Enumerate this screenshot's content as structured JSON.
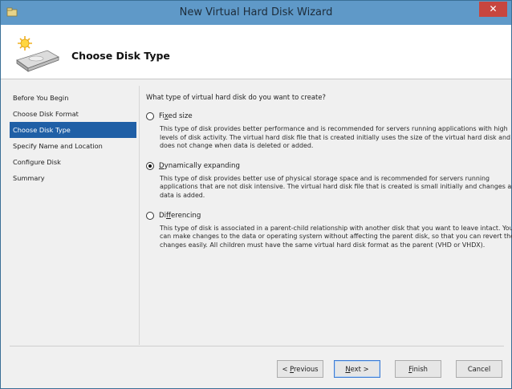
{
  "window": {
    "title": "New Virtual Hard Disk Wizard",
    "close_glyph": "✕"
  },
  "header": {
    "heading": "Choose Disk Type"
  },
  "nav": {
    "items": [
      {
        "label": "Before You Begin"
      },
      {
        "label": "Choose Disk Format"
      },
      {
        "label": "Choose Disk Type",
        "selected": true
      },
      {
        "label": "Specify Name and Location"
      },
      {
        "label": "Configure Disk"
      },
      {
        "label": "Summary"
      }
    ]
  },
  "main": {
    "question": "What type of virtual hard disk do you want to create?",
    "options": [
      {
        "label_prefix": "Fi",
        "label_underline": "x",
        "label_suffix": "ed size",
        "checked": false,
        "description": "This type of disk provides better performance and is recommended for servers running applications with high levels of disk activity. The virtual hard disk file that is created initially uses the size of the virtual hard disk and does not change when data is deleted or added."
      },
      {
        "label_prefix": "",
        "label_underline": "D",
        "label_suffix": "ynamically expanding",
        "checked": true,
        "description": "This type of disk provides better use of physical storage space and is recommended for servers running applications that are not disk intensive. The virtual hard disk file that is created is small initially and changes as data is added."
      },
      {
        "label_prefix": "Di",
        "label_underline": "f",
        "label_suffix": "ferencing",
        "checked": false,
        "description": "This type of disk is associated in a parent-child relationship with another disk that you want to leave intact. You can make changes to the data or operating system without affecting the parent disk, so that you can revert the changes easily. All children must have the same virtual hard disk format as the parent (VHD or VHDX)."
      }
    ]
  },
  "footer": {
    "previous": {
      "prefix": "< ",
      "underline": "P",
      "suffix": "revious"
    },
    "next": {
      "prefix": "",
      "underline": "N",
      "suffix": "ext >"
    },
    "finish": {
      "prefix": "",
      "underline": "F",
      "suffix": "inish"
    },
    "cancel": {
      "label": "Cancel"
    }
  },
  "colors": {
    "titlebar": "#5f99c8",
    "selected_nav": "#1f5fa6",
    "close_button": "#c7463f"
  }
}
